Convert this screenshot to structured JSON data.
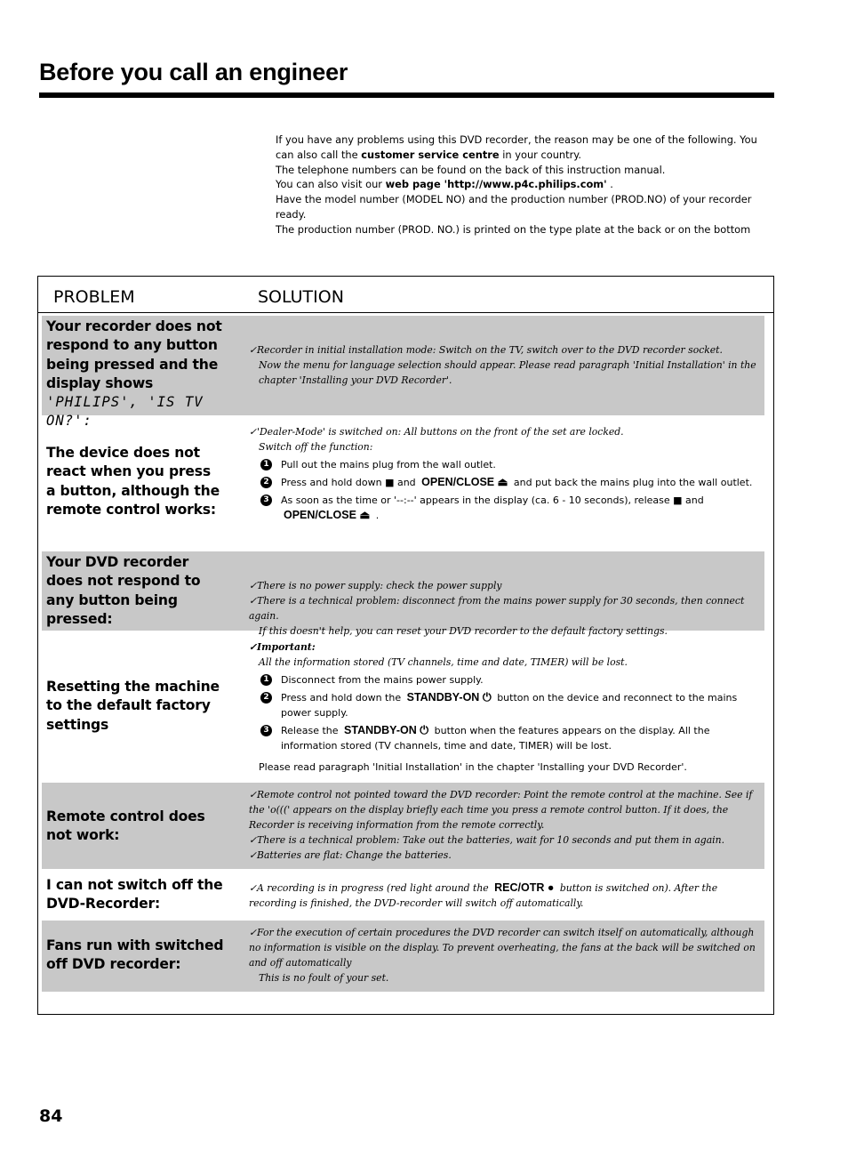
{
  "header": {
    "title": "Before you call an engineer"
  },
  "intro": {
    "line1_pre": "If you have any problems using this DVD recorder, the reason may be one of the following. You can also call the ",
    "line1_bold": "customer service centre",
    "line1_post": " in your country.",
    "line2": "The telephone numbers can be found on the back of this instruction manual.",
    "line3_pre": "You can also visit our ",
    "line3_bold": "web page 'http://www.p4c.philips.com'",
    "line3_post": " .",
    "line4": "Have the model number (MODEL NO) and the production number (PROD.NO) of your recorder ready.",
    "line5": "The production number (PROD. NO.) is printed on the type plate at the back or on the bottom"
  },
  "table": {
    "col_problem": "PROBLEM",
    "col_solution": "SOLUTION",
    "rows": [
      {
        "problem": "Your recorder does not respond to any button being pressed and the display shows",
        "problem_lcd": "'PHILIPS', 'IS TV ON?':",
        "solution": [
          "✓Recorder in initial installation mode: Switch on the TV, switch over to the DVD recorder socket.",
          "Now the menu for language selection should appear. Please read paragraph 'Initial Installation' in the chapter 'Installing your DVD Recorder'."
        ]
      },
      {
        "problem": "The device does not react when you press a button, although the remote control works:",
        "solution_intro": [
          "✓'Dealer-Mode' is switched on: All buttons on the front of the set are locked.",
          "Switch off the function:"
        ],
        "steps": [
          {
            "n": "1",
            "text": "Pull out the mains plug from the wall outlet."
          },
          {
            "n": "2",
            "pre": "Press and hold down ",
            "stop_icon": "■",
            "mid": " and ",
            "key": "OPEN/CLOSE",
            "key_icon": "⏏",
            "post": " and put back the mains plug into the wall outlet."
          },
          {
            "n": "3",
            "pre": "As soon as the time or '--:--' appears in the display (ca. 6 - 10 seconds), release ",
            "stop_icon": "■",
            "mid": " and",
            "key": "OPEN/CLOSE",
            "key_icon": "⏏",
            "post": " ."
          }
        ]
      },
      {
        "problem": "Your DVD recorder does not respond to any button being pressed:",
        "solution": [
          "✓There is no power supply: check the power supply",
          "✓There is a technical problem: disconnect from the mains power supply for 30 seconds, then connect again.",
          "If this doesn't help, you can reset your DVD recorder to the default factory settings."
        ]
      },
      {
        "problem": "Resetting the machine to the default factory settings",
        "important_label": "✓Important:",
        "important_text": "All the information stored (TV channels, time and date, TIMER) will be lost.",
        "steps": [
          {
            "n": "1",
            "text": "Disconnect from the mains power supply."
          },
          {
            "n": "2",
            "pre": "Press and hold down the ",
            "key": "STANDBY-ON",
            "key_icon": "⏻",
            "post": " button on the device and reconnect to the mains power supply."
          },
          {
            "n": "3",
            "pre": "Release the ",
            "key": "STANDBY-ON",
            "key_icon": "⏻",
            "post": " button when the features appears on the display. All the information stored (TV channels, time and date, TIMER) will be lost."
          }
        ],
        "footer": "Please read paragraph 'Initial Installation' in the chapter 'Installing your DVD Recorder'."
      },
      {
        "problem": "Remote control does not work:",
        "solution": [
          "✓Remote control not pointed toward the DVD recorder: Point the remote control at the machine. See if the 'o(((' appears on the display briefly each time you press a remote control button. If it does, the Recorder is receiving information from the remote correctly.",
          "✓There is a technical problem: Take out the batteries, wait for 10 seconds and put them in again.",
          "✓Batteries are flat: Change the batteries."
        ]
      },
      {
        "problem": "I can not switch off the DVD-Recorder:",
        "sol_pre": "✓A recording is in progress (red light around the ",
        "key": "REC/OTR",
        "key_icon": "●",
        "sol_post": " button is switched on). After the recording is finished, the DVD-recorder will switch off automatically."
      },
      {
        "problem": "Fans run with switched off DVD recorder:",
        "solution": [
          "✓For the execution of certain procedures the DVD recorder can switch itself on automatically, although no information is visible on the display. To prevent overheating, the fans at the back will be switched on and off automatically",
          "This is no foult of your set."
        ]
      }
    ]
  },
  "footer": {
    "page_number": "84"
  }
}
